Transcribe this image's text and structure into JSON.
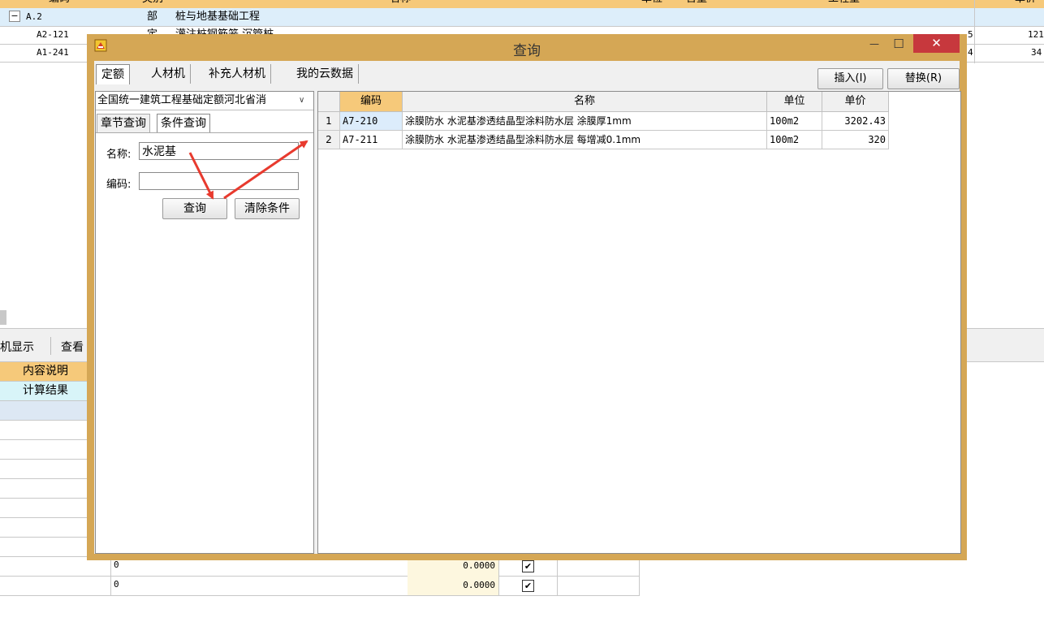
{
  "bg_table": {
    "header": {
      "code": "编码",
      "type": "类别",
      "name": "名称",
      "unit": "单位",
      "content": "含量",
      "qty": "工程量",
      "price": "单价"
    },
    "rows": [
      {
        "toggle": "−",
        "code": "A.2",
        "type": "部",
        "name": "桩与地基基础工程",
        "qty": "",
        "price": ""
      },
      {
        "code": "A2-121",
        "type": "定",
        "name": "灌注桩钢筋笼 沉管桩",
        "qty": "5",
        "price": "121"
      },
      {
        "code": "A1-241",
        "type": "",
        "name": "",
        "qty": "4",
        "price": "34"
      }
    ]
  },
  "bottom_panel": {
    "tabs": [
      "机显示",
      "查看"
    ],
    "col_header": "内容说明",
    "result_label": "计算结果",
    "rows": [
      {
        "value": "0",
        "amount": "0.0000",
        "checked": "✔"
      },
      {
        "value": "0",
        "amount": "0.0000",
        "checked": "✔"
      }
    ]
  },
  "dialog": {
    "title": "查询",
    "minimize": "—",
    "maximize": "☐",
    "close": "✕",
    "tabs": [
      "定额",
      "人材机",
      "补充人材机",
      "我的云数据"
    ],
    "insert_button": "插入(I)",
    "replace_button": "替换(R)",
    "library_select": "全国统一建筑工程基础定额河北省消",
    "subtabs": [
      "章节查询",
      "条件查询"
    ],
    "name_label": "名称:",
    "name_value": "水泥基",
    "code_label": "编码:",
    "code_value": "",
    "search_button": "查询",
    "clear_button": "清除条件",
    "grid": {
      "headers": {
        "code": "编码",
        "name": "名称",
        "unit": "单位",
        "price": "单价"
      },
      "rows": [
        {
          "index": "1",
          "code": "A7-210",
          "name": "涂膜防水 水泥基渗透结晶型涂料防水层 涂膜厚1mm",
          "unit": "100m2",
          "price": "3202.43"
        },
        {
          "index": "2",
          "code": "A7-211",
          "name": "涂膜防水 水泥基渗透结晶型涂料防水层 每增减0.1mm",
          "unit": "100m2",
          "price": "320"
        }
      ]
    }
  },
  "colors": {
    "dialog_frame": "#d5a755",
    "close_button": "#c7383d",
    "header_orange": "#f6c97a",
    "selected_cell": "#dcecfb",
    "annotation_red": "#e83a2e"
  }
}
